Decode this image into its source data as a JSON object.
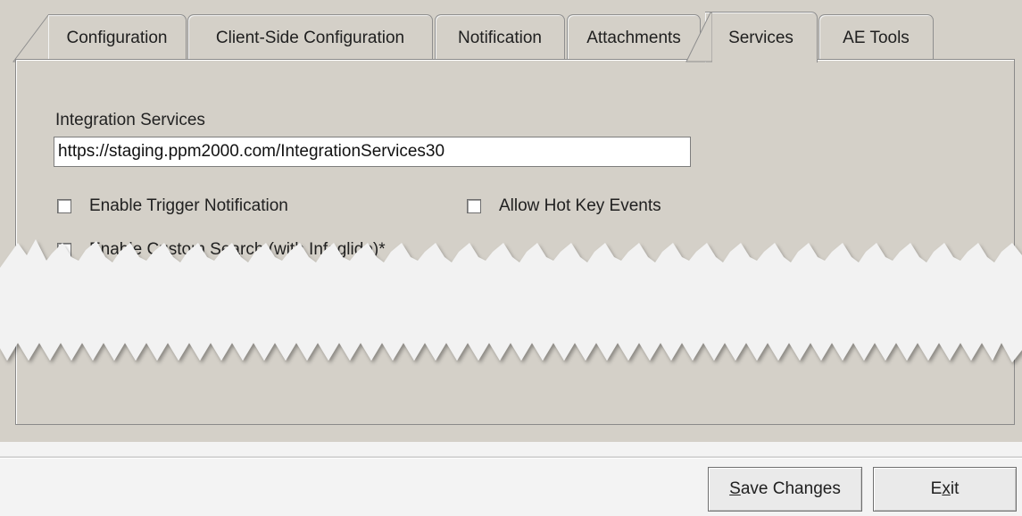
{
  "tabs": [
    {
      "label": "Configuration"
    },
    {
      "label": "Client-Side Configuration"
    },
    {
      "label": "Notification"
    },
    {
      "label": "Attachments"
    },
    {
      "label": "Services",
      "active": true
    },
    {
      "label": "AE Tools"
    }
  ],
  "integration": {
    "label": "Integration Services",
    "value": "https://staging.ppm2000.com/IntegrationServices30"
  },
  "options": {
    "enable_trigger_notification": {
      "label": "Enable Trigger Notification",
      "checked": false
    },
    "allow_hot_key_events": {
      "label": "Allow Hot Key Events",
      "checked": false
    },
    "enable_custom_search": {
      "label": "Enable Custom Search (with Infoglide)*",
      "checked": false
    }
  },
  "buttons": {
    "save_mnemonic": "S",
    "save_rest": "ave Changes",
    "exit_pre": "E",
    "exit_mnemonic": "x",
    "exit_rest": "it"
  },
  "colors": {
    "dialog_bg": "#d4d0c8",
    "bottom_bg": "#f3f3f3",
    "border": "#8a8a8a"
  }
}
